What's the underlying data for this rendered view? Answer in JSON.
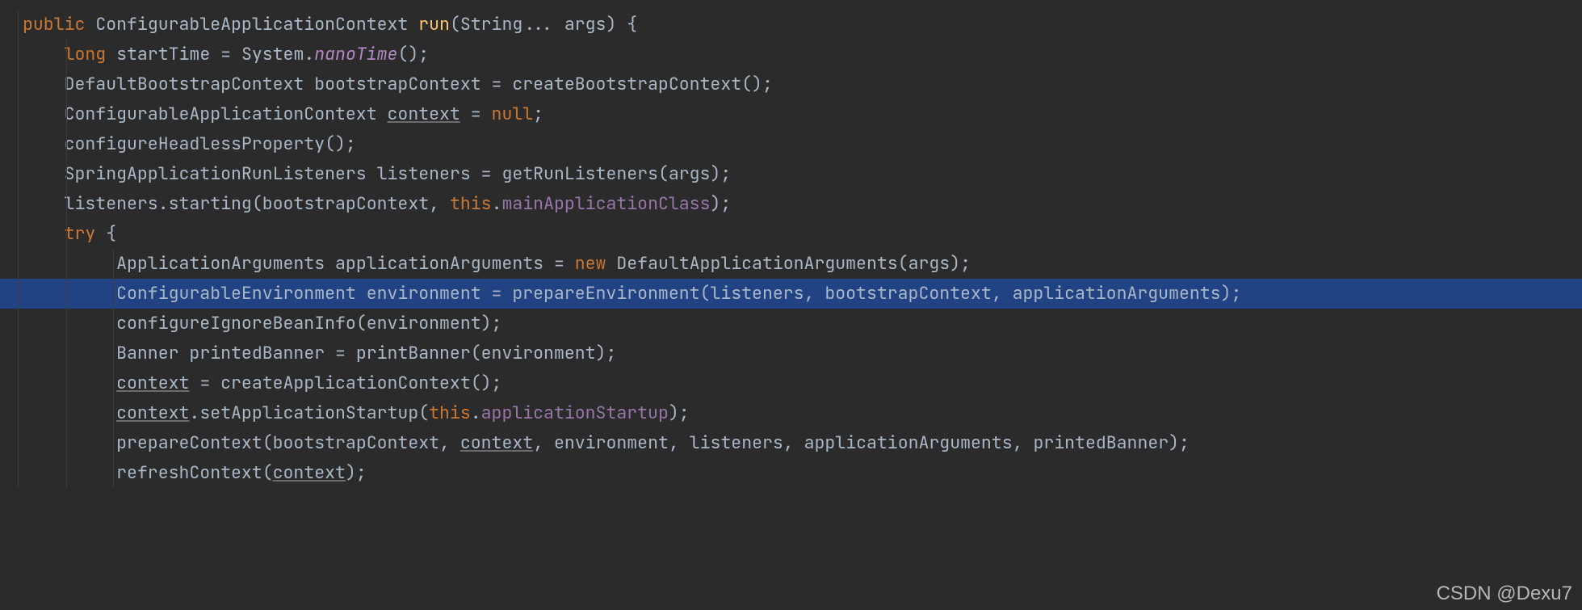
{
  "watermark": "CSDN @Dexu7",
  "code": {
    "kw_public": "public",
    "type_ctx": "ConfigurableApplicationContext",
    "method_run": "run",
    "type_string": "String",
    "varargs": "...",
    "param_args": "args",
    "open_brace": "{",
    "kw_long": "long",
    "var_startTime": "startTime",
    "var_system": "System",
    "call_nanoTime": "nanoTime",
    "type_dbc": "DefaultBootstrapContext",
    "var_bootstrapContext": "bootstrapContext",
    "call_createBootstrap": "createBootstrapContext",
    "var_context": "context",
    "kw_null": "null",
    "call_configHeadless": "configureHeadlessProperty",
    "type_listeners": "SpringApplicationRunListeners",
    "var_listeners": "listeners",
    "call_getRun": "getRunListeners",
    "call_starting": "starting",
    "kw_this": "this",
    "field_mainApp": "mainApplicationClass",
    "kw_try": "try",
    "type_appargs": "ApplicationArguments",
    "var_appargs": "applicationArguments",
    "kw_new": "new",
    "type_defappargs": "DefaultApplicationArguments",
    "type_env": "ConfigurableEnvironment",
    "var_env": "environment",
    "call_prepareEnv": "prepareEnvironment",
    "call_configIgnore": "configureIgnoreBeanInfo",
    "type_banner": "Banner",
    "var_printedBanner": "printedBanner",
    "call_printBanner": "printBanner",
    "call_createAppCtx": "createApplicationContext",
    "call_setAppStartup": "setApplicationStartup",
    "field_appStartup": "applicationStartup",
    "call_prepareCtx": "prepareContext",
    "call_refreshCtx": "refreshContext"
  }
}
